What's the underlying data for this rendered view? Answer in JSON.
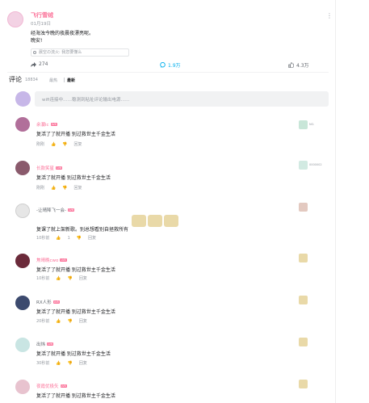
{
  "post": {
    "user": "飞行雪绒",
    "date": "01月19日",
    "line1": "经海浊今晚的夜晨夜漂亮呢。",
    "line2": "晚安!",
    "ref": "晨空の流火: 我您要懂么",
    "repost": "274",
    "comments": "1.9万",
    "likes": "4.3万",
    "more": "⋮"
  },
  "comments_header": {
    "title": "评论",
    "count": "18834",
    "sort_hot": "最热",
    "sort_new": "最新"
  },
  "input": {
    "placeholder": "wifi连接中……稳测到粘址评论输出电源……"
  },
  "comments": [
    {
      "user": "余瀾ic",
      "level": "LV6",
      "text": "复活了了就开播 别过救世主千金生活",
      "time": "刚刚",
      "reply": "回复",
      "badge": "NO.",
      "name_color": "#fb7299"
    },
    {
      "user": "长款笑星",
      "level": "LV6",
      "text": "复活了就开播 别过救世主千金生活",
      "time": "刚刚",
      "reply": "回复",
      "badge": "0000002",
      "name_color": "#fb7299"
    },
    {
      "user": "-让晴降飞一会-",
      "level": "LV6",
      "text": "复课了就上架新歌。别总想看别自拯救所有",
      "time": "10秒前",
      "likes": "1",
      "reply": "回复",
      "badge": "",
      "name_color": "#61666d"
    },
    {
      "user": "焦晴晚cwo",
      "level": "LV6",
      "text": "复活了了就开播 别过救世主千金生活",
      "time": "10秒前",
      "reply": "回复",
      "badge": "",
      "name_color": "#fb7299"
    },
    {
      "user": "RX人形",
      "level": "LV6",
      "text": "复活了了就开播 别过救世主千金生活",
      "time": "20秒前",
      "reply": "回复",
      "badge": "",
      "name_color": "#61666d"
    },
    {
      "user": "出炜",
      "level": "LV6",
      "text": "复活了就开播 别过救世主千金生活",
      "time": "30秒前",
      "reply": "回复",
      "badge": "",
      "name_color": "#61666d"
    },
    {
      "user": "夜霞优极矢",
      "level": "LV6",
      "text": "复活了了就开播 别过救世主千金生活",
      "time": "",
      "reply": "",
      "badge": "",
      "name_color": "#fb7299"
    }
  ]
}
